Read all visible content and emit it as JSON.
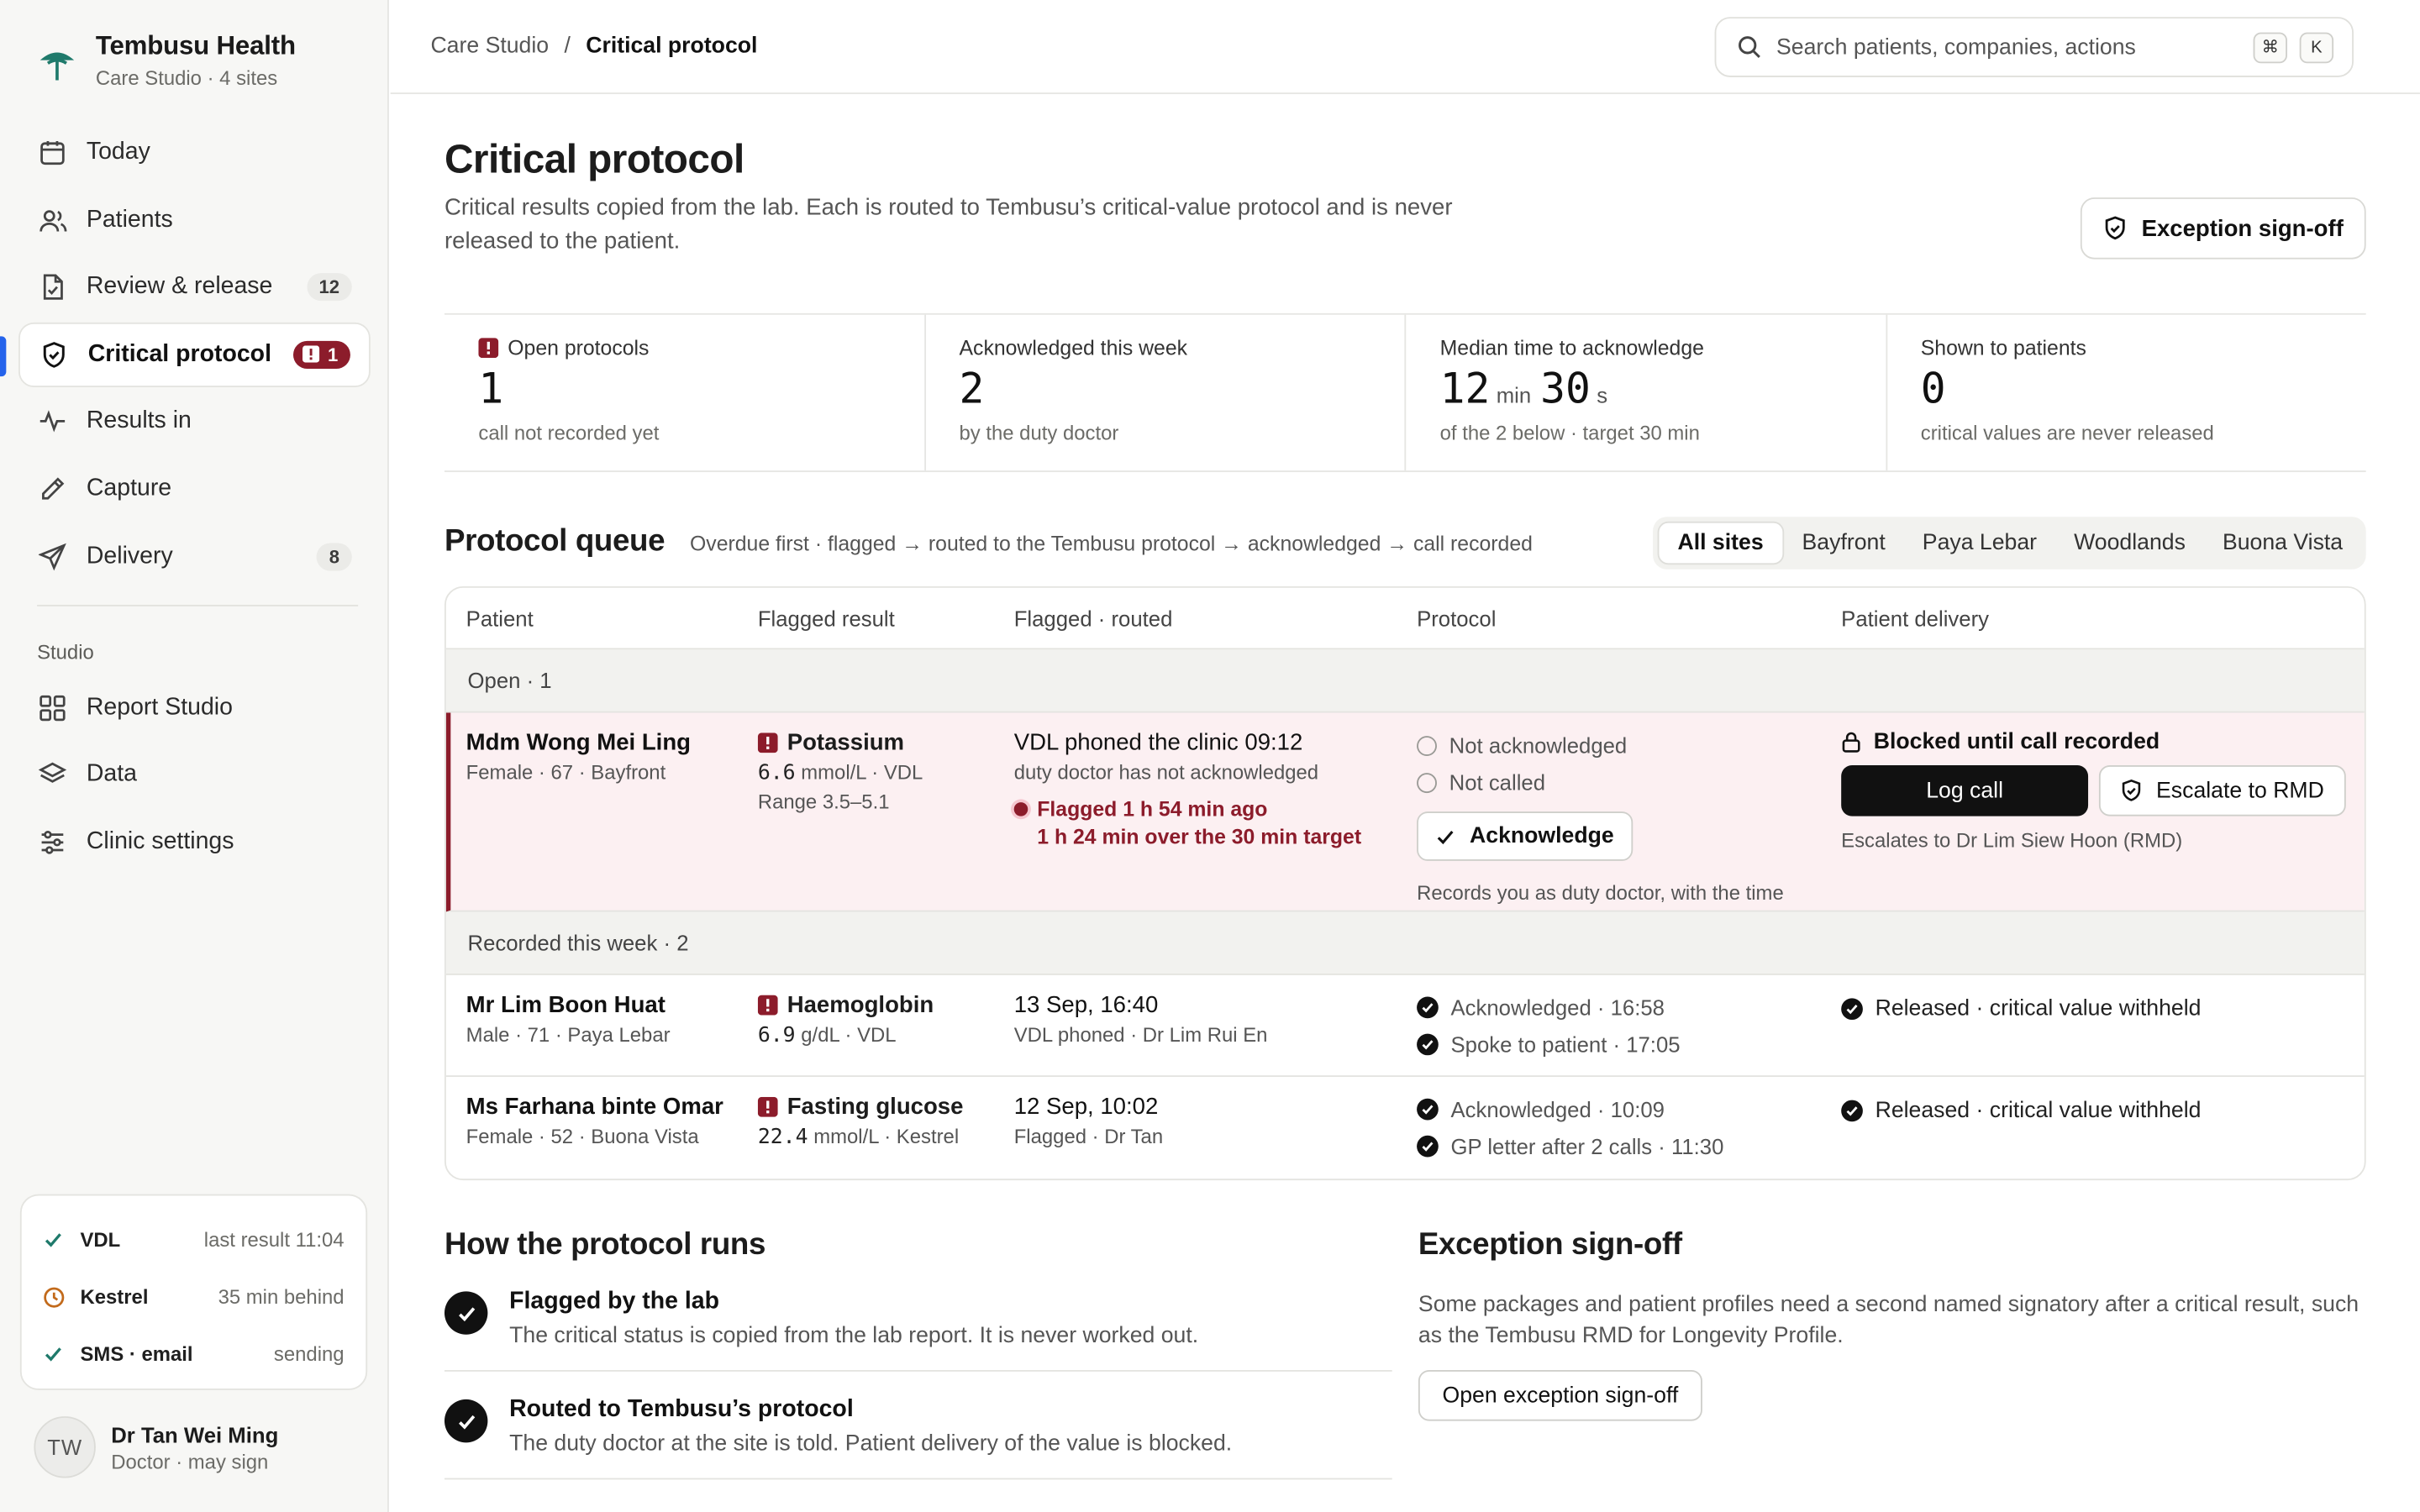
{
  "brand": {
    "name": "Tembusu Health",
    "sub": "Care Studio · 4 sites",
    "color": "#1f7a6b"
  },
  "nav": [
    {
      "label": "Today",
      "icon": "calendar-icon"
    },
    {
      "label": "Patients",
      "icon": "users-icon"
    },
    {
      "label": "Review & release",
      "icon": "document-check-icon",
      "badge": "12"
    },
    {
      "label": "Critical protocol",
      "icon": "shield-icon",
      "badge": "1",
      "active": true
    },
    {
      "label": "Results in",
      "icon": "pulse-icon"
    },
    {
      "label": "Capture",
      "icon": "pen-icon"
    },
    {
      "label": "Delivery",
      "icon": "send-icon",
      "badge": "8"
    }
  ],
  "studio": {
    "section": "Studio",
    "items": [
      {
        "label": "Report Studio",
        "icon": "grid-icon"
      },
      {
        "label": "Data",
        "icon": "layers-icon"
      },
      {
        "label": "Clinic settings",
        "icon": "sliders-icon"
      }
    ]
  },
  "status": [
    {
      "name": "VDL",
      "value": "last result 11:04",
      "icon": "check-icon",
      "color": "#1f7a6b"
    },
    {
      "name": "Kestrel",
      "value": "35 min behind",
      "icon": "clock-icon",
      "color": "#c26a1b"
    },
    {
      "name": "SMS · email",
      "value": "sending",
      "icon": "check-icon",
      "color": "#1f7a6b"
    }
  ],
  "user": {
    "initials": "TW",
    "name": "Dr Tan Wei Ming",
    "role": "Doctor · may sign"
  },
  "breadcrumb": {
    "root": "Care Studio",
    "sep": "/",
    "current": "Critical protocol"
  },
  "search": {
    "placeholder": "Search patients, companies, actions",
    "kbd1": "⌘",
    "kbd2": "K"
  },
  "page": {
    "title": "Critical protocol",
    "desc": "Critical results copied from the lab. Each is routed to Tembusu’s critical-value protocol and is never released to the patient.",
    "exception_button": "Exception sign-off"
  },
  "stats": [
    {
      "label": "Open protocols",
      "value": "1",
      "sub": "call not recorded yet",
      "alert": true
    },
    {
      "label": "Acknowledged this week",
      "value": "2",
      "sub": "by the duty doctor"
    },
    {
      "label": "Median time to acknowledge",
      "v1": "12",
      "u1": "min",
      "v2": "30",
      "u2": "s",
      "sub": "of the 2 below · target 30 min"
    },
    {
      "label": "Shown to patients",
      "value": "0",
      "sub": "critical values are never released"
    }
  ],
  "queue": {
    "title": "Protocol queue",
    "sub": "Overdue first · flagged → routed to the Tembusu protocol → acknowledged → call recorded",
    "filters": [
      "All sites",
      "Bayfront",
      "Paya Lebar",
      "Woodlands",
      "Buona Vista"
    ],
    "columns": [
      "Patient",
      "Flagged result",
      "Flagged · routed",
      "Protocol",
      "Patient delivery"
    ],
    "open_group": "Open · 1",
    "recorded_group": "Recorded this week · 2",
    "open": {
      "name": "Mdm Wong Mei Ling",
      "meta": "Female · 67 · Bayfront",
      "result": "Potassium",
      "value": "6.6",
      "unit": "mmol/L · VDL",
      "range": "Range 3.5–5.1",
      "flag_title": "VDL phoned the clinic 09:12",
      "flag_sub": "duty doctor has not acknowledged",
      "overdue1": "Flagged 1 h 54 min ago",
      "overdue2": "1 h 24 min over the 30 min target",
      "proto1": "Not acknowledged",
      "proto2": "Not called",
      "ack_button": "Acknowledge",
      "ack_note": "Records you as duty doctor, with the time",
      "blocked": "Blocked until call recorded",
      "log_button": "Log call",
      "escalate_button": "Escalate to RMD",
      "escalate_note": "Escalates to Dr Lim Siew Hoon (RMD)"
    },
    "recorded": [
      {
        "name": "Mr Lim Boon Huat",
        "meta": "Male · 71 · Paya Lebar",
        "result": "Haemoglobin",
        "value": "6.9",
        "unit": "g/dL · VDL",
        "flag_title": "13 Sep, 16:40",
        "flag_sub": "VDL phoned · Dr Lim Rui En",
        "proto1": "Acknowledged · 16:58",
        "proto2": "Spoke to patient · 17:05",
        "delivery": "Released · critical value withheld"
      },
      {
        "name": "Ms Farhana binte Omar",
        "meta": "Female · 52 · Buona Vista",
        "result": "Fasting glucose",
        "value": "22.4",
        "unit": "mmol/L · Kestrel",
        "flag_title": "12 Sep, 10:02",
        "flag_sub": "Flagged · Dr Tan",
        "proto1": "Acknowledged · 10:09",
        "proto2": "GP letter after 2 calls · 11:30",
        "delivery": "Released · critical value withheld"
      }
    ]
  },
  "how": {
    "title": "How the protocol runs",
    "steps": [
      {
        "title": "Flagged by the lab",
        "desc": "The critical status is copied from the lab report. It is never worked out."
      },
      {
        "title": "Routed to Tembusu’s protocol",
        "desc": "The duty doctor at the site is told. Patient delivery of the value is blocked."
      }
    ]
  },
  "exception": {
    "title": "Exception sign-off",
    "desc": "Some packages and patient profiles need a second named signatory after a critical result, such as the Tembusu RMD for Longevity Profile.",
    "button": "Open exception sign-off"
  },
  "colors": {
    "critical": "#8c1c2b",
    "critical_bg": "#fcf0f2",
    "accent": "#2563eb"
  }
}
